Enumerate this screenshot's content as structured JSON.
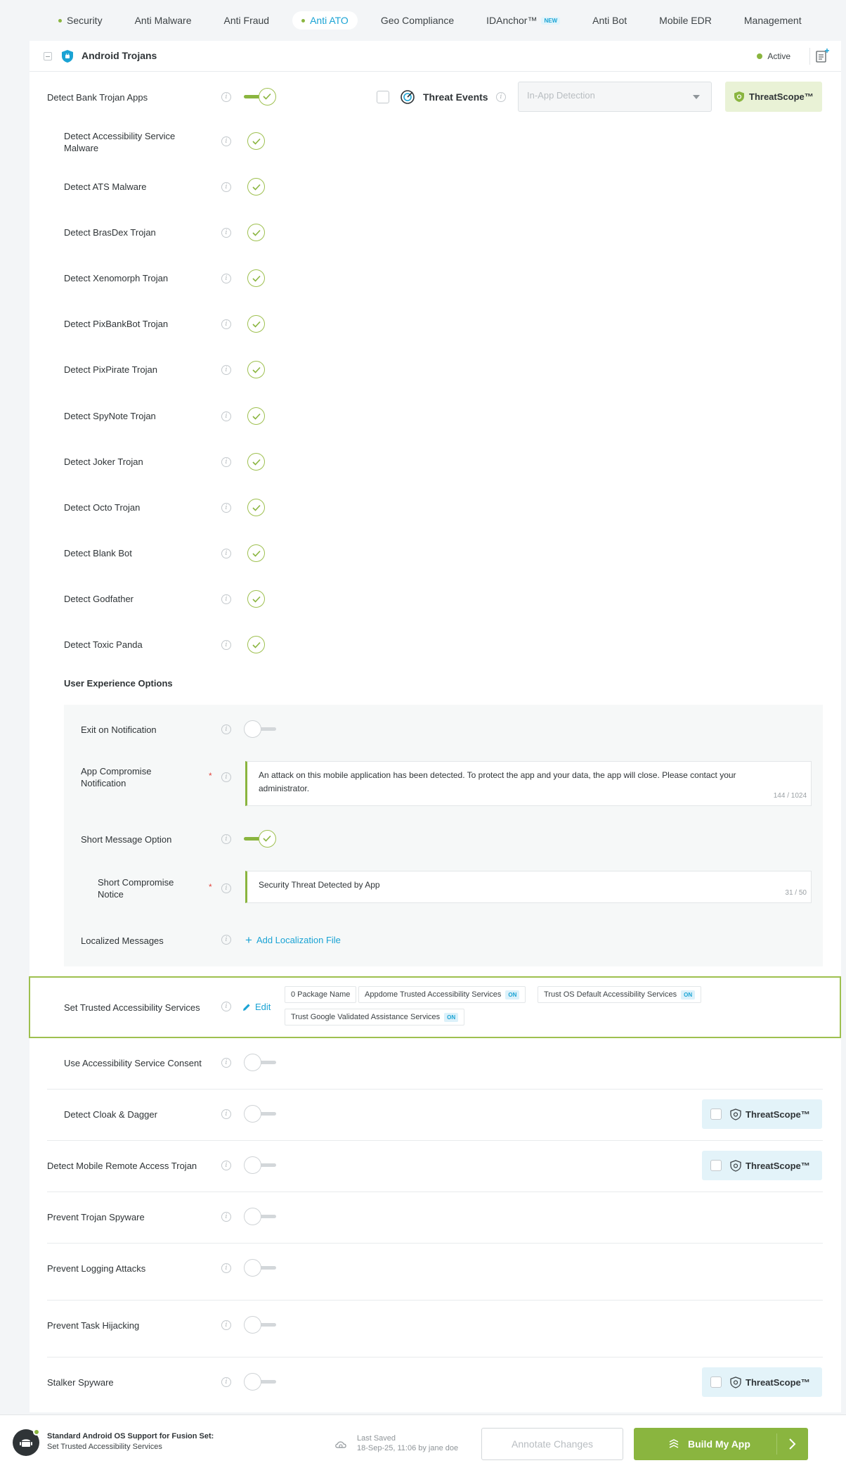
{
  "nav": {
    "tabs": [
      {
        "label": "Security"
      },
      {
        "label": "Anti Malware"
      },
      {
        "label": "Anti Fraud"
      },
      {
        "label": "Anti ATO"
      },
      {
        "label": "Geo Compliance"
      },
      {
        "label": "IDAnchor™",
        "badge": "NEW"
      },
      {
        "label": "Anti Bot"
      },
      {
        "label": "Mobile EDR"
      },
      {
        "label": "Management"
      }
    ]
  },
  "panel": {
    "title": "Android Trojans",
    "status": "Active"
  },
  "main_row": {
    "label": "Detect Bank Trojan Apps",
    "threat_events_label": "Threat Events",
    "dropdown_placeholder": "In-App Detection",
    "threatscope_label": "ThreatScope™"
  },
  "sub_options": [
    {
      "label": "Detect Accessibility Service Malware"
    },
    {
      "label": "Detect ATS Malware"
    },
    {
      "label": "Detect BrasDex Trojan"
    },
    {
      "label": "Detect Xenomorph Trojan"
    },
    {
      "label": "Detect PixBankBot Trojan"
    },
    {
      "label": "Detect PixPirate Trojan"
    },
    {
      "label": "Detect SpyNote Trojan"
    },
    {
      "label": "Detect Joker Trojan"
    },
    {
      "label": "Detect Octo Trojan"
    },
    {
      "label": "Detect Blank Bot"
    },
    {
      "label": "Detect Godfather"
    },
    {
      "label": "Detect Toxic Panda"
    }
  ],
  "ux": {
    "section_title": "User Experience Options",
    "exit_label": "Exit on Notification",
    "compromise_label": "App Compromise Notification",
    "compromise_text": "An attack on this mobile application has been detected. To protect the app and your data, the app will close. Please contact your administrator.",
    "compromise_counter": "144 / 1024",
    "short_option_label": "Short Message Option",
    "short_notice_label": "Short Compromise Notice",
    "short_text": "Security Threat Detected by App",
    "short_counter": "31 / 50",
    "localized_label": "Localized Messages",
    "add_localization": "Add Localization File"
  },
  "trusted": {
    "label": "Set Trusted Accessibility Services",
    "edit": "Edit",
    "chip_package": "0 Package Name",
    "chip_appdome": "Appdome Trusted Accessibility Services",
    "chip_os": "Trust OS Default Accessibility Services",
    "chip_google": "Trust Google Validated Assistance Services",
    "on": "ON"
  },
  "consent_label": "Use Accessibility Service Consent",
  "rows": [
    {
      "label": "Detect Cloak & Dagger",
      "threatscope": "ThreatScope™"
    },
    {
      "label": "Detect Mobile Remote Access Trojan",
      "threatscope": "ThreatScope™"
    },
    {
      "label": "Prevent Trojan Spyware"
    },
    {
      "label": "Prevent Logging Attacks"
    },
    {
      "label": "Prevent Task Hijacking"
    },
    {
      "label": "Stalker Spyware",
      "threatscope": "ThreatScope™"
    }
  ],
  "footer": {
    "title": "Standard Android OS Support for Fusion Set:",
    "subtitle": "Set Trusted Accessibility Services",
    "last_saved_label": "Last Saved",
    "last_saved_value": "18-Sep-25, 11:06 by jane doe",
    "annotate": "Annotate Changes",
    "build": "Build My App"
  },
  "colors": {
    "accent_green": "#8ab53f",
    "accent_blue": "#1aa3d4",
    "required_red": "#e2453d"
  },
  "icons": [
    "shield-android-icon",
    "notes-add-icon",
    "info-icon",
    "check-icon",
    "radar-icon",
    "caret-down-icon",
    "threatscope-shield-icon",
    "pencil-icon",
    "plus-icon",
    "android-icon",
    "cloud-sync-icon",
    "build-icon",
    "chevron-right-icon"
  ]
}
